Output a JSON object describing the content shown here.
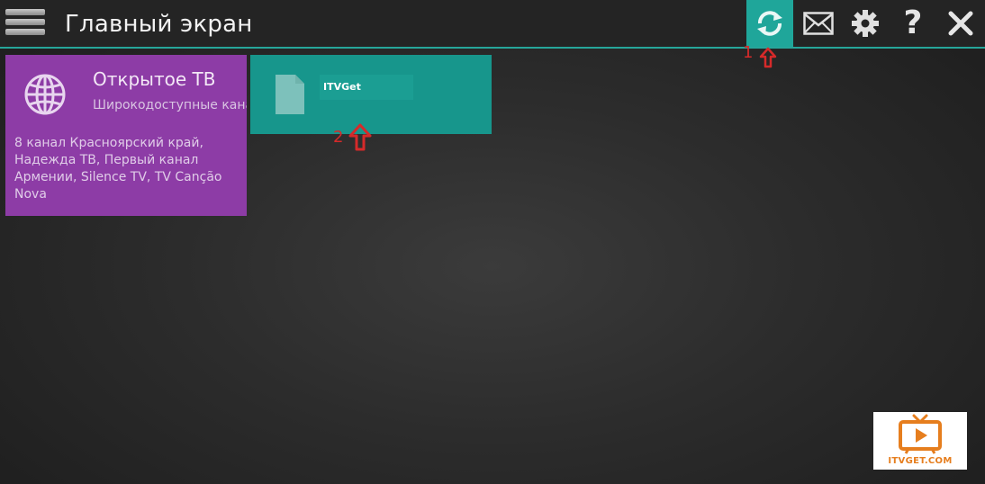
{
  "header": {
    "title": "Главный экран"
  },
  "toolbar": {
    "refresh_icon": "refresh-icon",
    "mail_icon": "envelope-icon",
    "settings_icon": "gear-icon",
    "help_label": "?",
    "close_icon": "close-icon",
    "accent_color": "#1fa69a"
  },
  "tiles": [
    {
      "icon": "globe-icon",
      "title": "Открытое ТВ",
      "subtitle": "Широкодоступные каналы",
      "description": "8 канал Красноярский край, Надежда ТВ, Первый канал Армении, Silence TV, TV Canção Nova",
      "color": "#8d3ca6"
    },
    {
      "icon": "file-icon",
      "title": "ITVGet",
      "color": "#17968c"
    }
  ],
  "annotations": [
    {
      "label": "1"
    },
    {
      "label": "2"
    }
  ],
  "logo": {
    "text": "ITVGET.COM"
  }
}
